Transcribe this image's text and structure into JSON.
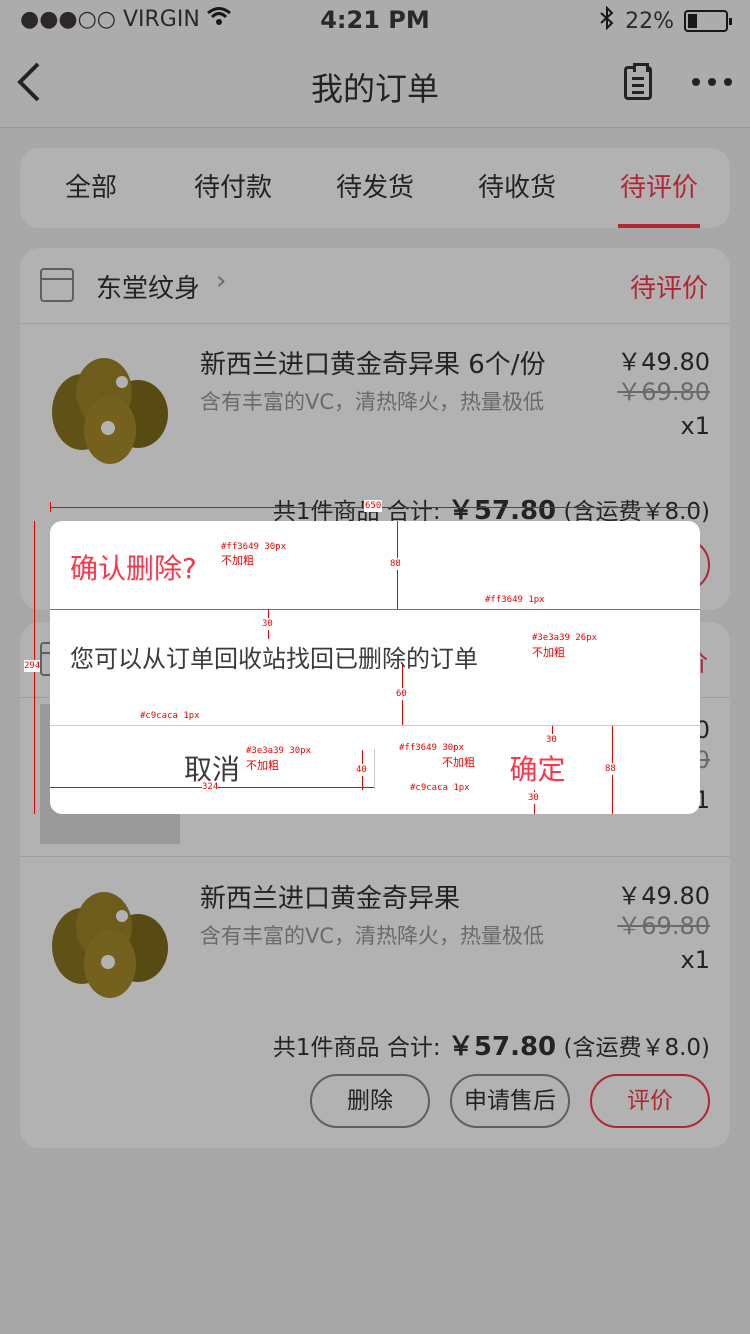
{
  "status_bar": {
    "carrier": "●●●○○ VIRGIN",
    "time": "4:21 PM",
    "battery": "22%"
  },
  "nav": {
    "back_icon": "chevron-left-icon",
    "title": "我的订单",
    "clipboard_icon": "clipboard-icon",
    "more_icon": "more-icon"
  },
  "tabs": [
    "全部",
    "待付款",
    "待发货",
    "待收货",
    "待评价"
  ],
  "active_tab": "待评价",
  "orders": [
    {
      "store": "东堂纹身",
      "status": "待评价",
      "item": {
        "title": "新西兰进口黄金奇异果 6个/份",
        "desc": "含有丰富的VC，清热降火，热量极低",
        "price": "￥49.80",
        "orig_price": "￥69.80",
        "qty": "x1"
      },
      "summary": {
        "count": "共1件商品",
        "total_label": "合计:",
        "total": "￥57.80",
        "shipping": "(含运费￥8.0)"
      }
    },
    {
      "status": "价",
      "item": {
        "price_tail": "0",
        "orig_tail": "0",
        "qty_tail": "1"
      }
    },
    {
      "item": {
        "title": "新西兰进口黄金奇异果",
        "desc": "含有丰富的VC，清热降火，热量极低",
        "price": "￥49.80",
        "orig_price": "￥69.80",
        "qty": "x1"
      },
      "summary": {
        "count": "共1件商品",
        "total_label": "合计:",
        "total": "￥57.80",
        "shipping": "(含运费￥8.0)"
      },
      "buttons": {
        "delete": "删除",
        "after_sale": "申请售后",
        "review": "评价"
      }
    }
  ],
  "dialog": {
    "title": "确认删除?",
    "message": "您可以从订单回收站找回已删除的订单",
    "cancel": "取消",
    "confirm": "确定"
  },
  "annotations": {
    "width": "650",
    "height": "294",
    "title_spec": "#ff3649  30px",
    "title_weight": "不加粗",
    "title_height": "88",
    "line1_spec": "#ff3649  1px",
    "msg_top": "30",
    "msg_spec": "#3e3a39  26px",
    "msg_weight": "不加粗",
    "msg_bottom": "60",
    "line2_spec": "#c9caca  1px",
    "cancel_spec": "#3e3a39  30px",
    "cancel_weight": "不加粗",
    "confirm_spec": "#ff3649  30px",
    "confirm_weight": "不加粗",
    "btn_top": "30",
    "btn_bottom": "30",
    "btn_height": "88",
    "vline_height": "40",
    "cancel_width": "324",
    "vline_spec": "#c9caca  1px"
  },
  "colors": {
    "accent": "#ff3649",
    "text": "#3e3a39",
    "divider": "#c9caca"
  }
}
